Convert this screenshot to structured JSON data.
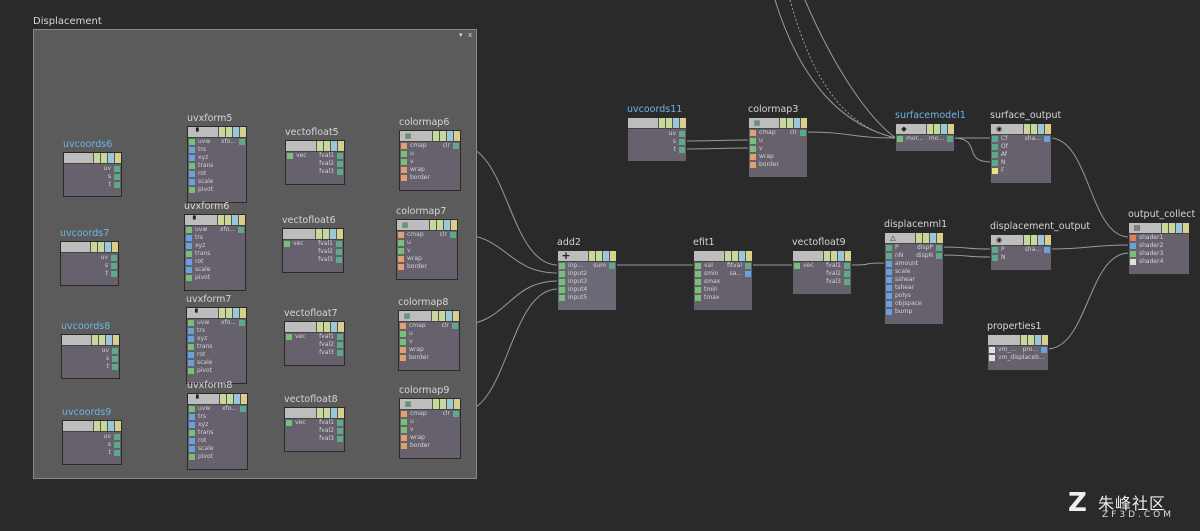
{
  "network_box": {
    "title": "Displacement",
    "controls": [
      "▾",
      "x"
    ]
  },
  "colors": {
    "input_port": "#78c078",
    "output_port": "#5fa88a",
    "blue_port": "#6aa0dc",
    "orange_port": "#e0a070",
    "yellow_port": "#e6e67a",
    "selected_highlight": "#66aadd",
    "uv_label": "#6cb6e8"
  },
  "nodes": [
    {
      "id": "uvcoords6",
      "label": "uvcoords6",
      "uv": true,
      "icon": "",
      "inputs": [],
      "outputs": [
        "uv",
        "s",
        "t"
      ]
    },
    {
      "id": "uvxform5",
      "label": "uvxform5",
      "icon": "uvxform-icon",
      "inputs": [
        "uvw",
        "trs",
        "xyz",
        "trans",
        "rot",
        "scale",
        "pivot"
      ],
      "outputs": [
        "xfo..."
      ]
    },
    {
      "id": "vectofloat5",
      "label": "vectofloat5",
      "icon": "",
      "inputs": [
        "vec"
      ],
      "outputs": [
        "fval1",
        "fval2",
        "fval3"
      ]
    },
    {
      "id": "colormap6",
      "label": "colormap6",
      "icon": "colormap-icon",
      "inputs": [
        "cmap",
        "u",
        "v",
        "wrap",
        "border"
      ],
      "outputs": [
        "clr"
      ]
    },
    {
      "id": "uvcoords7",
      "label": "uvcoords7",
      "uv": true,
      "icon": "",
      "inputs": [],
      "outputs": [
        "uv",
        "s",
        "t"
      ]
    },
    {
      "id": "uvxform6",
      "label": "uvxform6",
      "icon": "uvxform-icon",
      "inputs": [
        "uvw",
        "trs",
        "xyz",
        "trans",
        "rot",
        "scale",
        "pivot"
      ],
      "outputs": [
        "xfo..."
      ]
    },
    {
      "id": "vectofloat6",
      "label": "vectofloat6",
      "icon": "",
      "inputs": [
        "vec"
      ],
      "outputs": [
        "fval1",
        "fval2",
        "fval3"
      ]
    },
    {
      "id": "colormap7",
      "label": "colormap7",
      "icon": "colormap-icon",
      "inputs": [
        "cmap",
        "u",
        "v",
        "wrap",
        "border"
      ],
      "outputs": [
        "clr"
      ]
    },
    {
      "id": "uvcoords8",
      "label": "uvcoords8",
      "uv": true,
      "icon": "",
      "inputs": [],
      "outputs": [
        "uv",
        "s",
        "t"
      ]
    },
    {
      "id": "uvxform7",
      "label": "uvxform7",
      "icon": "uvxform-icon",
      "inputs": [
        "uvw",
        "trs",
        "xyz",
        "trans",
        "rot",
        "scale",
        "pivot"
      ],
      "outputs": [
        "xfo..."
      ]
    },
    {
      "id": "vectofloat7",
      "label": "vectofloat7",
      "icon": "",
      "inputs": [
        "vec"
      ],
      "outputs": [
        "fval1",
        "fval2",
        "fval3"
      ]
    },
    {
      "id": "colormap8",
      "label": "colormap8",
      "icon": "colormap-icon",
      "inputs": [
        "cmap",
        "u",
        "v",
        "wrap",
        "border"
      ],
      "outputs": [
        "clr"
      ]
    },
    {
      "id": "uvcoords9",
      "label": "uvcoords9",
      "uv": true,
      "icon": "",
      "inputs": [],
      "outputs": [
        "uv",
        "s",
        "t"
      ]
    },
    {
      "id": "uvxform8",
      "label": "uvxform8",
      "icon": "uvxform-icon",
      "inputs": [
        "uvw",
        "trs",
        "xyz",
        "trans",
        "rot",
        "scale",
        "pivot"
      ],
      "outputs": [
        "xfo..."
      ]
    },
    {
      "id": "vectofloat8",
      "label": "vectofloat8",
      "icon": "",
      "inputs": [
        "vec"
      ],
      "outputs": [
        "fval1",
        "fval2",
        "fval3"
      ]
    },
    {
      "id": "colormap9",
      "label": "colormap9",
      "icon": "colormap-icon",
      "inputs": [
        "cmap",
        "u",
        "v",
        "wrap",
        "border"
      ],
      "outputs": [
        "clr"
      ]
    },
    {
      "id": "add2",
      "label": "add2",
      "icon": "plus-icon",
      "inputs": [
        "inp...",
        "input2",
        "input3",
        "input4",
        "input5"
      ],
      "outputs": [
        "sum"
      ]
    },
    {
      "id": "efit1",
      "label": "efit1",
      "icon": "",
      "inputs": [
        "val",
        "smin",
        "smax",
        "tmin",
        "tmax"
      ],
      "outputs": [
        "fitval",
        "sa..."
      ]
    },
    {
      "id": "vectofloat9",
      "label": "vectofloat9",
      "icon": "",
      "inputs": [
        "vec"
      ],
      "outputs": [
        "fval1",
        "fval2",
        "fval3"
      ]
    },
    {
      "id": "displacenml1",
      "label": "displacenml1",
      "icon": "warning-icon",
      "inputs": [
        "P",
        "nN",
        "amount",
        "scale",
        "sshear",
        "tshear",
        "polys",
        "objspace",
        "bump"
      ],
      "outputs": [
        "dispP",
        "dispN"
      ]
    },
    {
      "id": "displacement_output",
      "label": "displacement_output",
      "icon": "output-icon",
      "inputs": [
        "P",
        "N"
      ],
      "outputs": [
        "sha..."
      ]
    },
    {
      "id": "uvcoords11",
      "label": "uvcoords11",
      "uv": true,
      "icon": "",
      "inputs": [],
      "outputs": [
        "uv",
        "s",
        "t"
      ]
    },
    {
      "id": "colormap3",
      "label": "colormap3",
      "icon": "colormap-icon",
      "inputs": [
        "cmap",
        "u",
        "v",
        "wrap",
        "border"
      ],
      "outputs": [
        "clr"
      ]
    },
    {
      "id": "surfacemodel1",
      "label": "surfacemodel1",
      "uv": true,
      "icon": "surface-icon",
      "inputs": [
        "mor..."
      ],
      "outputs": [
        "mo..."
      ]
    },
    {
      "id": "surface_output",
      "label": "surface_output",
      "icon": "output-icon",
      "inputs": [
        "Cf",
        "Of",
        "Af",
        "N",
        "F"
      ],
      "outputs": [
        "sha..."
      ]
    },
    {
      "id": "output_collect",
      "label": "output_collect",
      "icon": "collect-icon",
      "inputs": [
        "shader1",
        "shader2",
        "shader3",
        "shader4"
      ],
      "outputs": []
    },
    {
      "id": "properties1",
      "label": "properties1",
      "icon": "",
      "inputs": [
        "vm_...",
        "vm_displaceb..."
      ],
      "outputs": [
        "pro..."
      ]
    }
  ],
  "watermark": {
    "logo": "Z",
    "text_cn": "朱峰社区",
    "text_en": "ZF3D.COM"
  }
}
